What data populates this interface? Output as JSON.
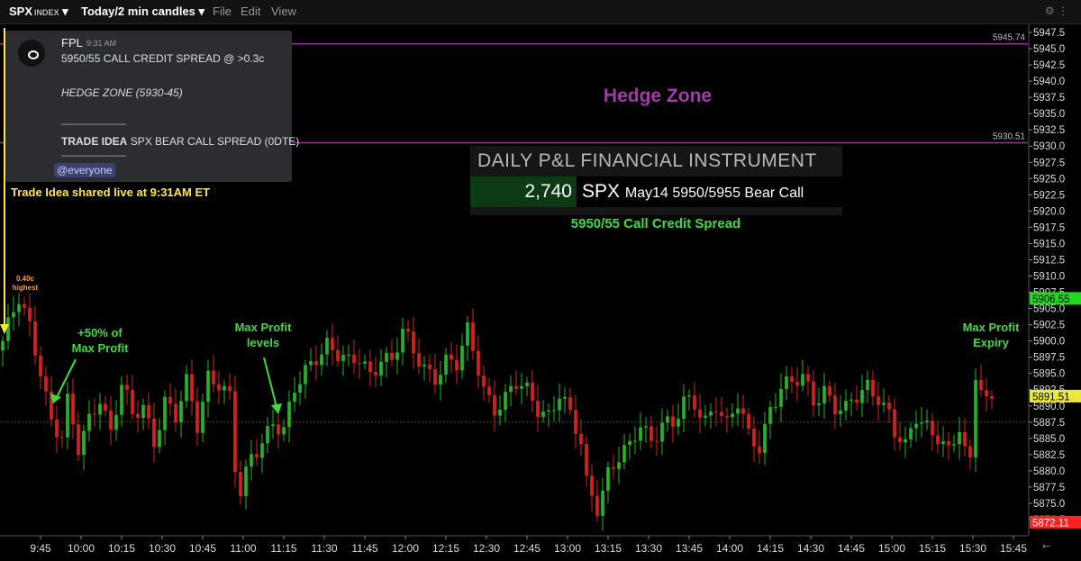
{
  "toolbar": {
    "symbol": "SPX",
    "symbol_suffix": "INDEX",
    "timeframe": "Today/2 min candles",
    "menu": [
      "File",
      "Edit",
      "View"
    ]
  },
  "notification": {
    "user": "FPL",
    "time": "9:31 AM",
    "line1": "5950/55 CALL CREDIT SPREAD @ >0.3c",
    "line2": "HEDGE ZONE (5930-45)",
    "divider": "——————",
    "trade_idea_label": "TRADE IDEA",
    "trade_idea_text": "SPX BEAR CALL SPREAD (0DTE)",
    "mention": "@everyone"
  },
  "annotations": {
    "shared": "Trade Idea shared live at 9:31AM ET",
    "highest_1": "0.40c",
    "highest_2": "highest",
    "fifty_1": "+50% of",
    "fifty_2": "Max Profit",
    "levels_1": "Max Profit",
    "levels_2": "levels",
    "expiry_1": "Max Profit",
    "expiry_2": "Expiry",
    "hedge_zone": "Hedge Zone",
    "credit_spread": "5950/55 Call Credit Spread"
  },
  "pnl": {
    "header": "DAILY P&L FINANCIAL INSTRUMENT",
    "value": "2,740",
    "instrument_symbol": "SPX",
    "instrument_rest": "May14 5950/5955 Bear Call"
  },
  "colors": {
    "up": "#22b422",
    "down": "#d71f1f",
    "hedge_line": "#9b2f9b",
    "annotation_green": "#3ddc3d",
    "annotation_yellow": "#ffe640",
    "annotation_orange": "#ff9a2e",
    "hedge_text": "#a23aa8"
  },
  "chart_data": {
    "type": "candlestick",
    "ylim": [
      5870.0,
      5949.0
    ],
    "y_ticks": [
      5872.5,
      5875,
      5877.5,
      5880,
      5882.5,
      5885,
      5887.5,
      5890,
      5892.5,
      5895,
      5897.5,
      5900,
      5902.5,
      5905,
      5907.5,
      5910,
      5912.5,
      5915,
      5917.5,
      5920,
      5922.5,
      5925,
      5927.5,
      5930,
      5932.5,
      5935,
      5937.5,
      5940,
      5942.5,
      5945,
      5947.5
    ],
    "x_ticks": [
      "9:45",
      "10:00",
      "10:15",
      "10:30",
      "10:45",
      "11:00",
      "11:15",
      "11:30",
      "11:45",
      "12:00",
      "12:15",
      "12:30",
      "12:45",
      "13:00",
      "13:15",
      "13:30",
      "13:45",
      "14:00",
      "14:15",
      "14:30",
      "14:45",
      "15:00",
      "15:15",
      "15:30",
      "15:45"
    ],
    "session_start": "9:30",
    "bar_minutes": 2,
    "levels": [
      {
        "label": "5945.74",
        "value": 5945.74
      },
      {
        "label": "5930.51",
        "value": 5930.51
      }
    ],
    "price_tags": [
      {
        "label": "5906.55",
        "value": 5906.55,
        "bg": "#1fd81f",
        "fg": "#000"
      },
      {
        "label": "5891.51",
        "value": 5891.51,
        "bg": "#eaea3a",
        "fg": "#000"
      },
      {
        "label": "5872.11",
        "value": 5872.11,
        "bg": "#ff2222",
        "fg": "#fff"
      }
    ],
    "reference_line": 5887.5,
    "anchors": [
      [
        0,
        5900
      ],
      [
        1,
        5902
      ],
      [
        3,
        5906
      ],
      [
        5,
        5902
      ],
      [
        7,
        5896
      ],
      [
        9,
        5888
      ],
      [
        11,
        5885
      ],
      [
        12,
        5890
      ],
      [
        14,
        5883
      ],
      [
        16,
        5888
      ],
      [
        18,
        5892
      ],
      [
        20,
        5886
      ],
      [
        22,
        5893
      ],
      [
        24,
        5888
      ],
      [
        26,
        5890
      ],
      [
        28,
        5885
      ],
      [
        30,
        5891
      ],
      [
        32,
        5888
      ],
      [
        34,
        5893
      ],
      [
        36,
        5887
      ],
      [
        38,
        5895
      ],
      [
        40,
        5894
      ],
      [
        42,
        5891
      ],
      [
        43,
        5880
      ],
      [
        44,
        5876
      ],
      [
        46,
        5882
      ],
      [
        48,
        5885
      ],
      [
        50,
        5888
      ],
      [
        52,
        5886
      ],
      [
        54,
        5892
      ],
      [
        56,
        5895
      ],
      [
        58,
        5898
      ],
      [
        60,
        5900
      ],
      [
        62,
        5898
      ],
      [
        64,
        5896
      ],
      [
        66,
        5897
      ],
      [
        68,
        5895
      ],
      [
        70,
        5898
      ],
      [
        72,
        5897
      ],
      [
        74,
        5901
      ],
      [
        76,
        5898
      ],
      [
        78,
        5896
      ],
      [
        80,
        5895
      ],
      [
        82,
        5897
      ],
      [
        84,
        5896
      ],
      [
        86,
        5901
      ],
      [
        88,
        5896
      ],
      [
        89,
        5893
      ],
      [
        91,
        5890
      ],
      [
        93,
        5891
      ],
      [
        95,
        5893
      ],
      [
        97,
        5892
      ],
      [
        99,
        5890
      ],
      [
        101,
        5889
      ],
      [
        103,
        5892
      ],
      [
        105,
        5888
      ],
      [
        107,
        5884
      ],
      [
        108,
        5878
      ],
      [
        110,
        5875
      ],
      [
        112,
        5880
      ],
      [
        114,
        5882
      ],
      [
        116,
        5883
      ],
      [
        118,
        5887
      ],
      [
        120,
        5885
      ],
      [
        122,
        5888
      ],
      [
        124,
        5887
      ],
      [
        126,
        5890
      ],
      [
        128,
        5890
      ],
      [
        130,
        5888
      ],
      [
        132,
        5891
      ],
      [
        134,
        5887
      ],
      [
        136,
        5890
      ],
      [
        138,
        5885
      ],
      [
        140,
        5884
      ],
      [
        142,
        5890
      ],
      [
        144,
        5893
      ],
      [
        146,
        5893
      ],
      [
        148,
        5894
      ],
      [
        150,
        5891
      ],
      [
        152,
        5893
      ],
      [
        154,
        5890
      ],
      [
        156,
        5889
      ],
      [
        158,
        5891
      ],
      [
        160,
        5893
      ],
      [
        162,
        5892
      ],
      [
        164,
        5889
      ],
      [
        165,
        5886
      ],
      [
        167,
        5883
      ],
      [
        169,
        5888
      ],
      [
        171,
        5887
      ],
      [
        173,
        5886
      ],
      [
        175,
        5883
      ],
      [
        177,
        5886
      ],
      [
        178,
        5882
      ],
      [
        179,
        5881
      ],
      [
        180,
        5895
      ],
      [
        182,
        5891
      ],
      [
        183,
        5892
      ]
    ]
  }
}
